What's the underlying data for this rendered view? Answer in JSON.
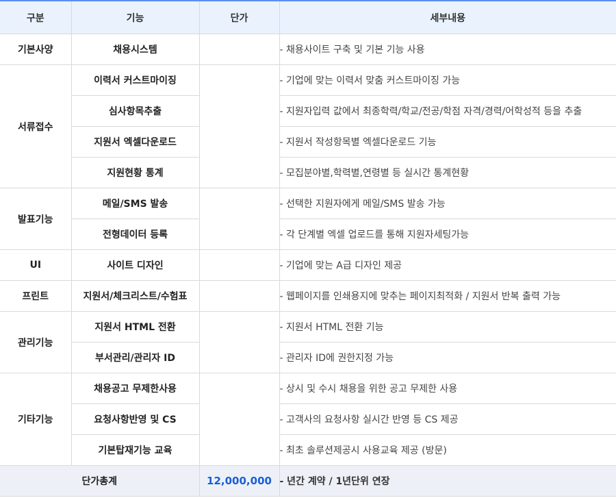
{
  "header": {
    "category": "구분",
    "function": "기능",
    "price": "단가",
    "detail": "세부내용"
  },
  "groups": [
    {
      "category": "기본사양",
      "items": [
        {
          "function": "채용시스템",
          "detail": "- 채용사이트 구축 및 기본 기능 사용"
        }
      ]
    },
    {
      "category": "서류접수",
      "items": [
        {
          "function": "이력서 커스트마이징",
          "detail": "- 기업에 맞는 이력서 맞춤 커스트마이징 가능"
        },
        {
          "function": "심사항목추출",
          "detail": "- 지원자입력 값에서 최종학력/학교/전공/학점 자격/경력/어학성적 등을 추출"
        },
        {
          "function": "지원서 엑셀다운로드",
          "detail": "- 지원서 작성항목별 엑셀다운로드 기능"
        },
        {
          "function": "지원현황 통계",
          "detail": "- 모집분야별,학력별,연령별 등 실시간 통계현황"
        }
      ]
    },
    {
      "category": "발표기능",
      "items": [
        {
          "function": "메일/SMS 발송",
          "detail": "- 선택한 지원자에게 메일/SMS 발송 가능"
        },
        {
          "function": "전형데이터 등록",
          "detail": "- 각 단계별 엑셀 업로드를 통해 지원자세팅가능"
        }
      ]
    },
    {
      "category": "UI",
      "items": [
        {
          "function": "사이트 디자인",
          "detail": "- 기업에 맞는 A급 디자인 제공"
        }
      ]
    },
    {
      "category": "프린트",
      "items": [
        {
          "function": "지원서/체크리스트/수험표",
          "detail": "- 웹페이지를 인쇄용지에 맞추는 페이지최적화 / 지원서 반복 출력 가능"
        }
      ]
    },
    {
      "category": "관리기능",
      "items": [
        {
          "function": "지원서 HTML 전환",
          "detail": "- 지원서 HTML 전환 기능"
        },
        {
          "function": "부서관리/관리자 ID",
          "detail": "- 관리자 ID에 권한지정 가능"
        }
      ]
    },
    {
      "category": "기타기능",
      "items": [
        {
          "function": "채용공고 무제한사용",
          "detail": "- 상시 및 수시 채용을 위한 공고 무제한 사용"
        },
        {
          "function": "요청사항반영 및 CS",
          "detail": "- 고객사의 요청사항 실시간 반영 등 CS 제공"
        },
        {
          "function": "기본탑재기능 교육",
          "detail": "- 최초 솔루션제공시 사용교육 제공 (방문)"
        }
      ]
    }
  ],
  "total": {
    "label": "단가총계",
    "price": "12,000,000",
    "detail": "- 년간 계약 / 1년단위 연장"
  },
  "colors": {
    "header_bg": "#eaf2fe",
    "top_border": "#5b8def",
    "total_bg": "#edf1f7",
    "price_text": "#1a5fd6"
  }
}
